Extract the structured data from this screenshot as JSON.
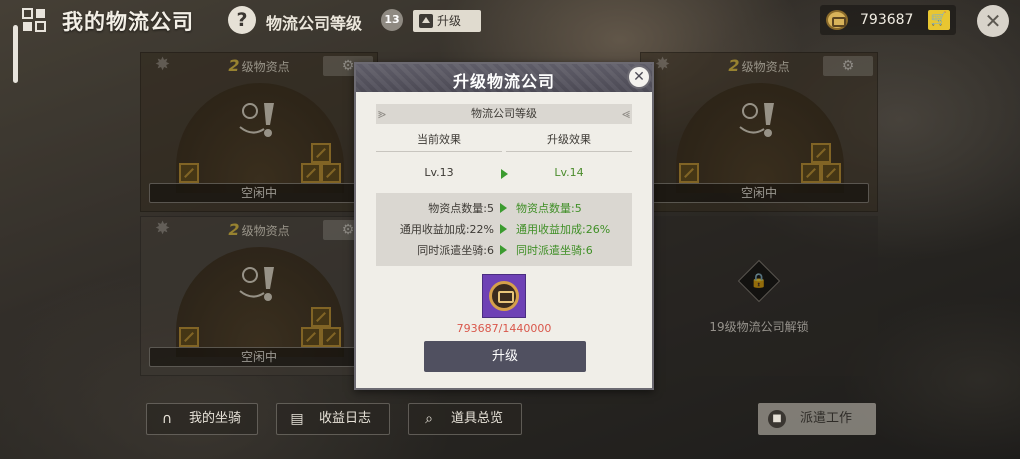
{
  "header": {
    "title": "我的物流公司",
    "help_glyph": "?",
    "company_level_label": "物流公司等级",
    "company_level": "13",
    "upgrade_label": "升级",
    "currency_amount": "793687",
    "close_glyph": "✕"
  },
  "stations": [
    {
      "level": "2",
      "title": "级物资点",
      "status": "空闲中"
    },
    {
      "level": "2",
      "title": "级物资点",
      "status": "空闲中"
    },
    {
      "level": "2",
      "title": "级物资点",
      "status": "空闲中"
    }
  ],
  "locked_station": {
    "text": "19级物流公司解锁"
  },
  "bottom_buttons": {
    "mounts": "我的坐骑",
    "income_log": "收益日志",
    "items_overview": "道具总览",
    "dispatch": "派遣工作"
  },
  "modal": {
    "title": "升级物流公司",
    "section_label": "物流公司等级",
    "current_header": "当前效果",
    "next_header": "升级效果",
    "current_level": "Lv.13",
    "next_level": "Lv.14",
    "stats": [
      {
        "current": "物资点数量:5",
        "next": "物资点数量:5"
      },
      {
        "current": "通用收益加成:22%",
        "next": "通用收益加成:26%"
      },
      {
        "current": "同时派遣坐骑:6",
        "next": "同时派遣坐骑:6"
      }
    ],
    "progress_text": "793687/1440000",
    "progress_current": 793687,
    "progress_required": 1440000,
    "upgrade_button": "升级"
  },
  "colors": {
    "accent_green": "#3f8f26",
    "progress_red": "#d9574b",
    "modal_header": "#55535e",
    "gold": "#e8c84a"
  }
}
